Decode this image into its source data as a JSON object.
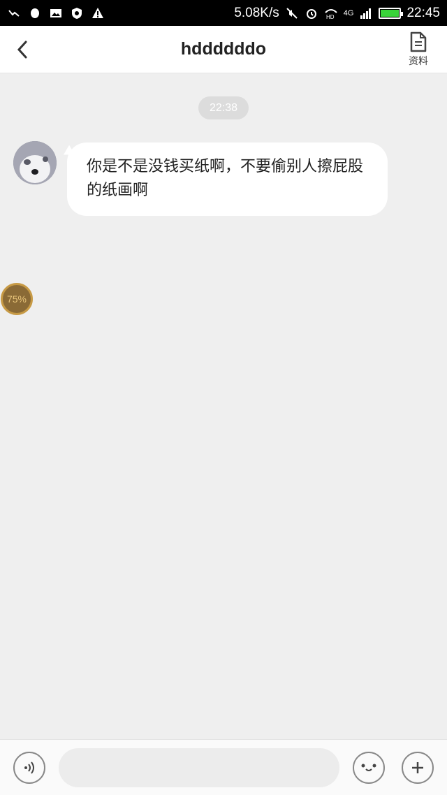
{
  "status_bar": {
    "speed": "5.08K/s",
    "network": "4G",
    "time": "22:45"
  },
  "header": {
    "title": "hddddddo",
    "profile_label": "资料"
  },
  "chat": {
    "timestamp": "22:38",
    "messages": [
      {
        "text": "你是不是没钱买纸啊，不要偷别人擦屁股的纸画啊"
      }
    ],
    "floating_badge": "75%"
  },
  "input_bar": {
    "placeholder": ""
  },
  "icons": {
    "back": "chevron-left-icon",
    "profile": "document-icon",
    "voice": "voice-icon",
    "emoji": "emoji-icon",
    "plus": "plus-icon"
  },
  "colors": {
    "background": "#efefef",
    "header_bg": "#ffffff",
    "bubble_bg": "#ffffff",
    "time_pill_bg": "#dcdcdc",
    "battery_fill": "#3ad33a"
  }
}
